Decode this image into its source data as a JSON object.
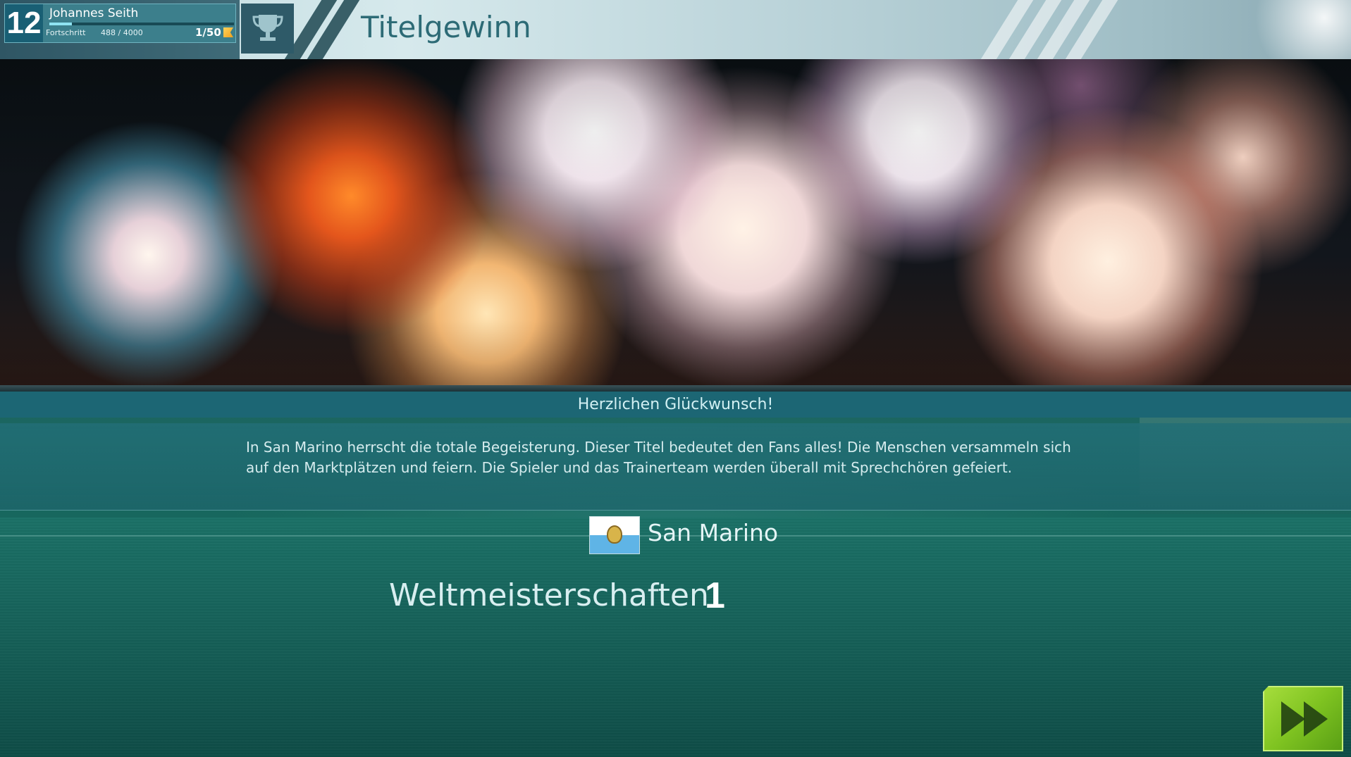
{
  "profile": {
    "level": "12",
    "name": "Johannes Seith",
    "progress_label": "Fortschritt",
    "progress_value": "488 / 4000",
    "progress_fraction": 0.122,
    "counter": "1/50"
  },
  "header": {
    "title": "Titelgewinn",
    "icon": "trophy-icon"
  },
  "banner": {
    "image": "fireworks"
  },
  "message": {
    "headline": "Herzlichen Glückwunsch!",
    "body": "In San Marino herrscht die totale Begeisterung. Dieser Titel bedeutet den Fans alles! Die Menschen versammeln sich auf den Marktplätzen und feiern. Die Spieler und das Trainerteam werden überall mit Sprechchören gefeiert."
  },
  "country": {
    "name": "San Marino",
    "flag_colors": [
      "#ffffff",
      "#5fb4e6"
    ]
  },
  "stats": {
    "label": "Weltmeisterschaften",
    "value": "1"
  },
  "next_button": {
    "icon": "fast-forward-icon",
    "color": "#7fc321"
  }
}
